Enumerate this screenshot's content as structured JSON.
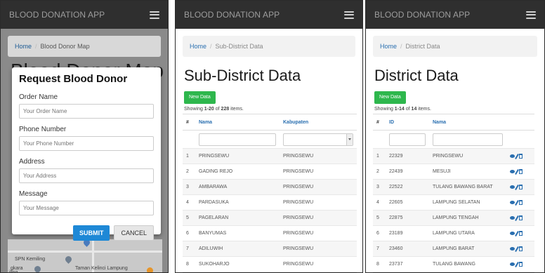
{
  "screen1": {
    "app_title": "BLOOD DONATION APP",
    "breadcrumb": {
      "home": "Home",
      "separator": "/",
      "current": "Blood Donor Map"
    },
    "background_title": "Blood Donor Map",
    "modal": {
      "title": "Request Blood Donor",
      "fields": [
        {
          "label": "Order Name",
          "placeholder": "Your Order Name"
        },
        {
          "label": "Phone Number",
          "placeholder": "Your Phone Number"
        },
        {
          "label": "Address",
          "placeholder": "Your Address"
        },
        {
          "label": "Message",
          "placeholder": "Your Message"
        }
      ],
      "submit_label": "SUBMIT",
      "cancel_label": "CANCEL"
    },
    "map": {
      "label1": "SPN Kemiling",
      "label2": "Taman Kelinci Lampung",
      "label3": "gkara",
      "label4": "iling"
    }
  },
  "screen2": {
    "app_title": "BLOOD DONATION APP",
    "breadcrumb": {
      "home": "Home",
      "separator": "/",
      "current": "Sub-District Data"
    },
    "page_title": "Sub-District Data",
    "new_button": "New Data",
    "showing": {
      "prefix": "Showing ",
      "range": "1-20",
      "middle": " of ",
      "total": "228",
      "suffix": " items."
    },
    "columns": [
      "#",
      "Nama",
      "Kabupaten"
    ],
    "rows": [
      [
        "1",
        "PRINGSEWU",
        "PRINGSEWU"
      ],
      [
        "2",
        "GADING REJO",
        "PRINGSEWU"
      ],
      [
        "3",
        "AMBARAWA",
        "PRINGSEWU"
      ],
      [
        "4",
        "PARDASUKA",
        "PRINGSEWU"
      ],
      [
        "5",
        "PAGELARAN",
        "PRINGSEWU"
      ],
      [
        "6",
        "BANYUMAS",
        "PRINGSEWU"
      ],
      [
        "7",
        "ADILUWIH",
        "PRINGSEWU"
      ],
      [
        "8",
        "SUKOHARJO",
        "PRINGSEWU"
      ]
    ]
  },
  "screen3": {
    "app_title": "BLOOD DONATION APP",
    "breadcrumb": {
      "home": "Home",
      "separator": "/",
      "current": "District Data"
    },
    "page_title": "District Data",
    "new_button": "New Data",
    "showing": {
      "prefix": "Showing ",
      "range": "1-14",
      "middle": " of ",
      "total": "14",
      "suffix": " items."
    },
    "columns": [
      "#",
      "ID",
      "Nama"
    ],
    "rows": [
      [
        "1",
        "22329",
        "PRINGSEWU"
      ],
      [
        "2",
        "22439",
        "MESUJI"
      ],
      [
        "3",
        "22522",
        "TULANG BAWANG BARAT"
      ],
      [
        "4",
        "22605",
        "LAMPUNG SELATAN"
      ],
      [
        "5",
        "22875",
        "LAMPUNG TENGAH"
      ],
      [
        "6",
        "23189",
        "LAMPUNG UTARA"
      ],
      [
        "7",
        "23460",
        "LAMPUNG BARAT"
      ],
      [
        "8",
        "23737",
        "TULANG BAWANG"
      ]
    ]
  },
  "icons": {
    "menu": "hamburger-icon",
    "view": "eye-icon",
    "edit": "pencil-icon",
    "delete": "trash-icon",
    "map_pin": "map-pin-icon"
  },
  "colors": {
    "navbar": "#2f2f2f",
    "link": "#2a6fb0",
    "new_button": "#2eb74d",
    "submit_button": "#1e88d6"
  }
}
